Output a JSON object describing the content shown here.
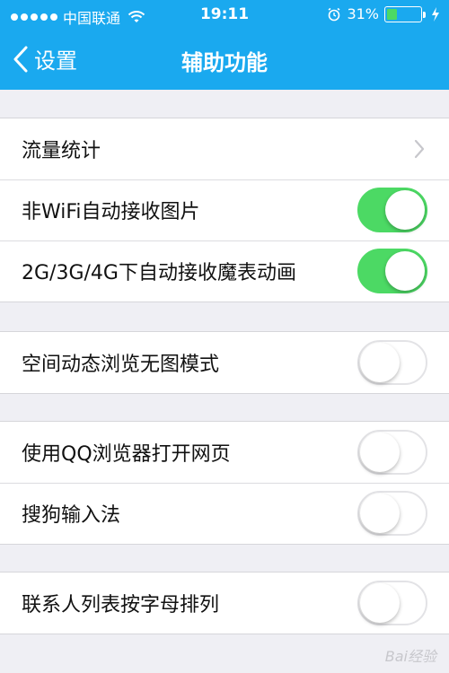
{
  "status_bar": {
    "carrier": "中国联通",
    "time": "19:11",
    "battery_percent": "31%",
    "battery_level": 0.31
  },
  "nav": {
    "back_label": "设置",
    "title": "辅助功能"
  },
  "groups": [
    {
      "rows": [
        {
          "label": "流量统计",
          "control": "chevron"
        },
        {
          "label": "非WiFi自动接收图片",
          "control": "toggle",
          "on": true
        },
        {
          "label": "2G/3G/4G下自动接收魔表动画",
          "control": "toggle",
          "on": true
        }
      ]
    },
    {
      "rows": [
        {
          "label": "空间动态浏览无图模式",
          "control": "toggle",
          "on": false
        }
      ]
    },
    {
      "rows": [
        {
          "label": "使用QQ浏览器打开网页",
          "control": "toggle",
          "on": false
        },
        {
          "label": "搜狗输入法",
          "control": "toggle",
          "on": false
        }
      ]
    },
    {
      "rows": [
        {
          "label": "联系人列表按字母排列",
          "control": "toggle",
          "on": false
        }
      ]
    }
  ],
  "colors": {
    "header": "#1aa9ef",
    "toggle_on": "#4cd964",
    "background": "#efeff4"
  },
  "watermark": "Bai经验"
}
